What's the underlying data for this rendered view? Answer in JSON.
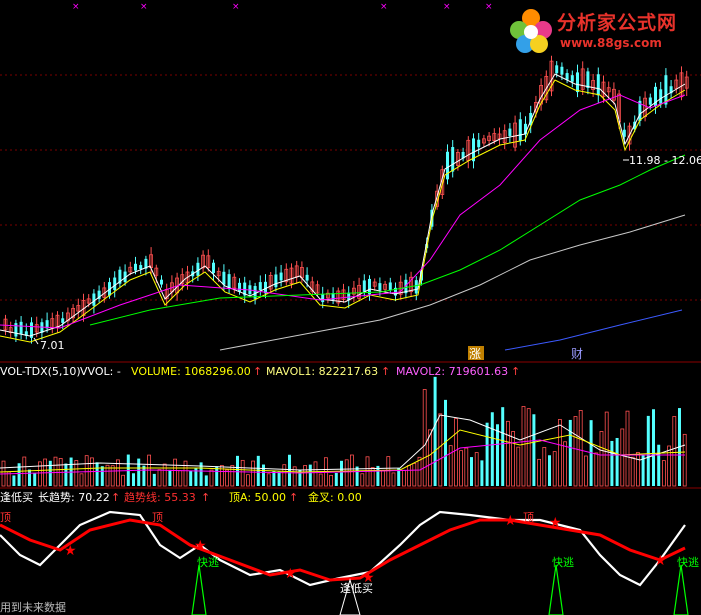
{
  "main": {
    "low_label": "7.01",
    "price_box": "11.98 - 12.06",
    "marker_a": "涨",
    "marker_b": "财"
  },
  "volume_panel": {
    "name": "VOL-TDX(5,10)",
    "vvol": "VVOL: -",
    "volume": "VOLUME: 1068296.00",
    "mavol1": "MAVOL1: 822217.63",
    "mavol2": "MAVOL2: 719601.63",
    "arrow": "↑"
  },
  "indicator_panel": {
    "name": "逢低买",
    "long_trend": "长趋势: 70.22",
    "trend_line": "趋势线: 55.33",
    "top_a": "顶A: 50.00",
    "golden_cross": "金叉: 0.00",
    "arrow": "↑",
    "signal_top": "顶",
    "signal_escape": "快逃",
    "signal_buy": "逢低买",
    "footer_note": "用到未来数据"
  },
  "logo": {
    "title": "分析家公式网",
    "url": "www.88gs.com"
  },
  "colors": {
    "up": "#ff5050",
    "down": "#54ffff",
    "ma_white": "#ffffff",
    "ma_yellow": "#ffff00",
    "ma_magenta": "#ff00ff",
    "ma_green": "#00ff00",
    "ma_gray": "#c8c8c8",
    "ma_blue": "#3c5aff",
    "divider": "#8b0000",
    "trend_red": "#ff0000"
  }
}
